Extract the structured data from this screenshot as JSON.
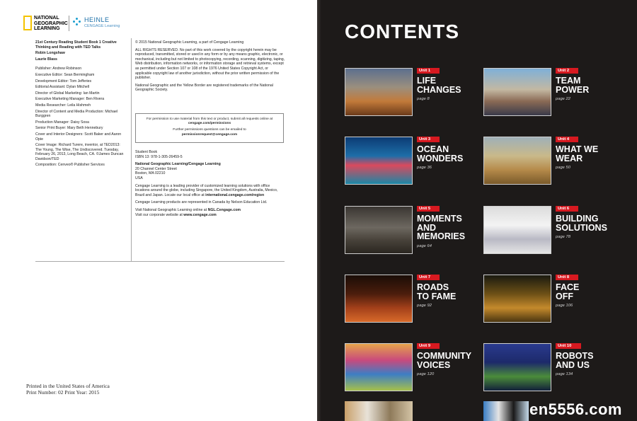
{
  "left": {
    "logo_ng": "NATIONAL GEOGRAPHIC LEARNING",
    "logo_heinle": "HEINLE",
    "logo_heinle_sub": "CENGAGE Learning",
    "book_title": "21st Century Reading Student Book 1 Creative Thinking and Reading with TED Talks",
    "authors": [
      "Robin Longshaw",
      "Laurie Blass"
    ],
    "credits": [
      "Publisher: Andrew Robinson",
      "Executive Editor: Sean Bermingham",
      "Development Editor: Tom Jefferies",
      "Editorial Assistant: Dylan Mitchell",
      "Director of Global Marketing: Ian Martin",
      "Executive Marketing Manager: Ben Rivera",
      "Media Researcher: Leila Hishmeh",
      "Director of Content and Media Production: Michael Burggren",
      "Production Manager: Daisy Sosa",
      "Senior Print Buyer: Mary Beth Hennebury",
      "Cover and Interior Designers: Scott Baker and Aaron Opie",
      "Cover Image: Richard Turere, inventor, at TED2013: The Young, The Wise, The Undiscovered. Tuesday, February 26, 2013, Long Beach, CA. ©James Duncan Davidson/TED",
      "Composition: Cenveo® Publisher Services"
    ],
    "copyright": "© 2015 National Geographic Learning, a part of Cengage Learning",
    "rights": "ALL RIGHTS RESERVED. No part of this work covered by the copyright herein may be reproduced, transmitted, stored or used in any form or by any means graphic, electronic, or mechanical, including but not limited to photocopying, recording, scanning, digitizing, taping, Web distribution, information networks, or information storage and retrieval systems, except as permitted under Section 107 or 108 of the 1976 United States Copyright Act, or applicable copyright law of another jurisdiction, without the prior written permission of the publisher.",
    "trademark": "National Geographic and the Yellow Border are registered trademarks of the National Geographic Society.",
    "perm_box_1a": "For permission to use material from this text or product, submit all requests online at",
    "perm_box_1b": "cengage.com/permissions",
    "perm_box_2a": "Further permissions questions can be emailed to",
    "perm_box_2b": "permissionrequest@cengage.com",
    "isbn_label": "Student Book",
    "isbn": "ISBN 13: 978-1-305-26459-5",
    "address": [
      "National Geographic Learning/Cengage Learning",
      "20 Channel Center Street",
      "Boston, MA 02210",
      "USA"
    ],
    "about": "Cengage Learning is a leading provider of customized learning solutions with office locations around the globe, including Singapore, the United Kingdom, Australia, Mexico, Brazil and Japan. Locate our local office at",
    "about_url": "international.cengage.com/region",
    "canada": "Cengage Learning products are represented in Canada by Nelson Education Ltd.",
    "visit_1a": "Visit National Geographic Learning online at",
    "visit_1b": "NGL.Cengage.com",
    "visit_2a": "Visit our corporate website at",
    "visit_2b": "www.cengage.com",
    "print_1": "Printed in the United States of America",
    "print_2": "Print Number: 02     Print Year: 2015"
  },
  "right": {
    "title": "CONTENTS",
    "watermark": "en5556.com",
    "units": [
      {
        "badge": "Unit 1",
        "title": "LIFE\nCHANGES",
        "page": "page 8"
      },
      {
        "badge": "Unit 2",
        "title": "TEAM\nPOWER",
        "page": "page 22"
      },
      {
        "badge": "Unit 3",
        "title": "OCEAN\nWONDERS",
        "page": "page 36"
      },
      {
        "badge": "Unit 4",
        "title": "WHAT WE\nWEAR",
        "page": "page 50"
      },
      {
        "badge": "Unit 5",
        "title": "MOMENTS\nAND\nMEMORIES",
        "page": "page 64"
      },
      {
        "badge": "Unit 6",
        "title": "BUILDING\nSOLUTIONS",
        "page": "page 78"
      },
      {
        "badge": "Unit 7",
        "title": "ROADS\nTO FAME",
        "page": "page 92"
      },
      {
        "badge": "Unit 8",
        "title": "FACE\nOFF",
        "page": "page 106"
      },
      {
        "badge": "Unit 9",
        "title": "COMMUNITY\nVOICES",
        "page": "page 120"
      },
      {
        "badge": "Unit 10",
        "title": "ROBOTS\nAND US",
        "page": "page 134"
      }
    ]
  }
}
